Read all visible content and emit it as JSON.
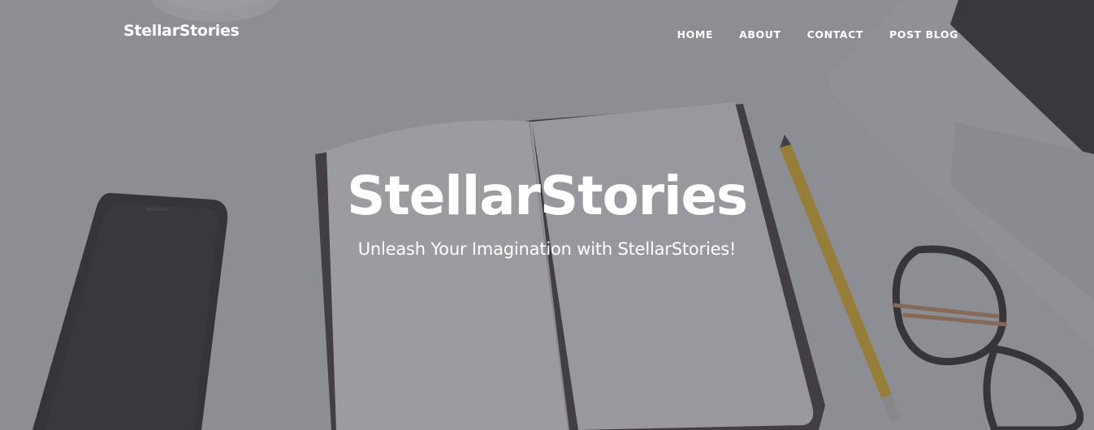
{
  "navbar": {
    "brand": "StellarStories",
    "links": [
      {
        "label": "HOME"
      },
      {
        "label": "ABOUT"
      },
      {
        "label": "CONTACT"
      },
      {
        "label": "POST BLOG"
      }
    ]
  },
  "hero": {
    "title": "StellarStories",
    "subtitle": "Unleash Your Imagination with StellarStories!",
    "overlay_color": "#4a4b52"
  },
  "background": {
    "objects": [
      "coffee-mug",
      "smartphone",
      "open-notebook",
      "pencil",
      "eyeglasses",
      "laptop"
    ]
  }
}
